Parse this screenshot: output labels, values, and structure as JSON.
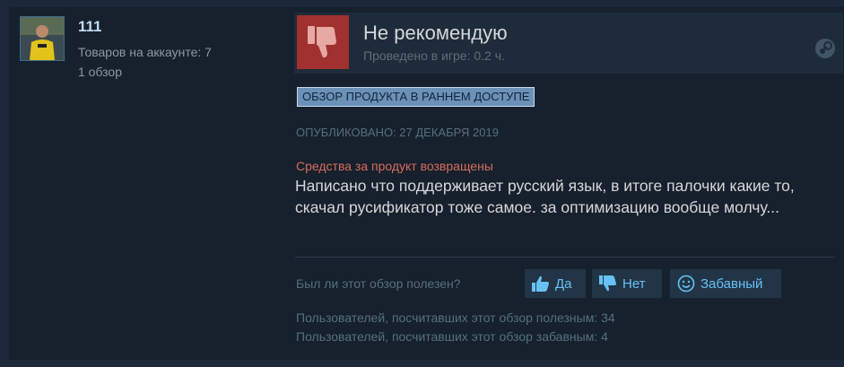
{
  "author": {
    "name": "111",
    "products_label": "Товаров на аккаунте: 7",
    "reviews_label": "1 обзор"
  },
  "review": {
    "verdict": "Не рекомендую",
    "playtime": "Проведено в игре: 0.2 ч.",
    "early_access_badge": "ОБЗОР ПРОДУКТА В РАННЕМ ДОСТУПЕ",
    "posted": "ОПУБЛИКОВАНО: 27 ДЕКАБРЯ 2019",
    "refunded": "Средства за продукт возвращены",
    "text": "Написано что поддерживает русский язык, в итоге палочки какие то, скачал русификатор тоже самое. за оптимизацию вообще молчу..."
  },
  "feedback": {
    "question": "Был ли этот обзор полезен?",
    "yes_label": "Да",
    "no_label": "Нет",
    "funny_label": "Забавный",
    "helpful_count_text": "Пользователей, посчитавших этот обзор полезным: 34",
    "funny_count_text": "Пользователей, посчитавших этот обзор забавным: 4"
  },
  "colors": {
    "page_bg": "#1b2838",
    "thumb_down_bg": "#a0312f",
    "link_blue": "#67c1f5",
    "refund_red": "#d46e5b"
  }
}
